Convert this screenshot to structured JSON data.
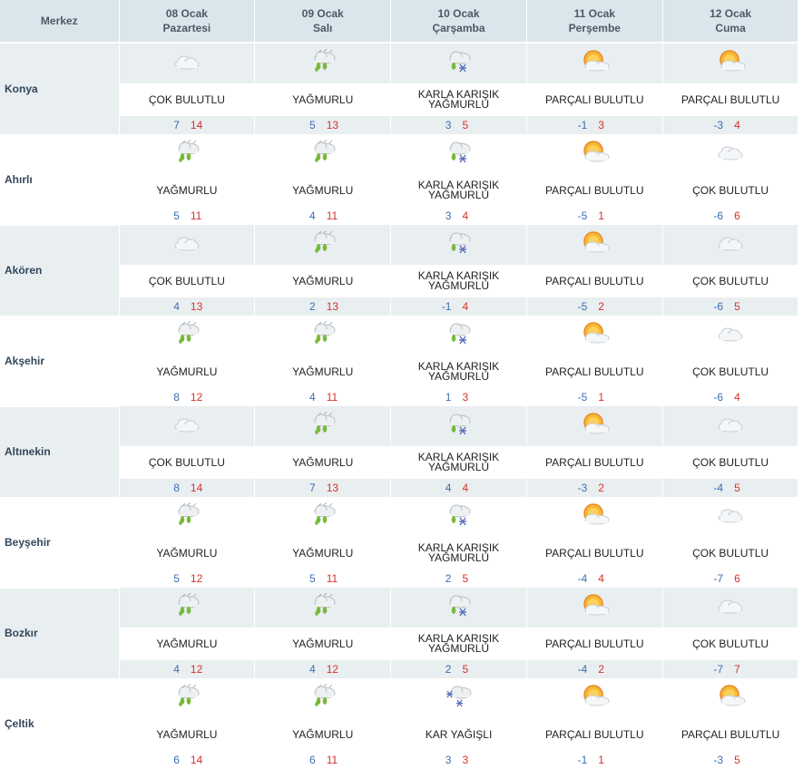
{
  "header": {
    "merkez_label": "Merkez",
    "days": [
      {
        "date": "08 Ocak",
        "weekday": "Pazartesi"
      },
      {
        "date": "09 Ocak",
        "weekday": "Salı"
      },
      {
        "date": "10 Ocak",
        "weekday": "Çarşamba"
      },
      {
        "date": "11 Ocak",
        "weekday": "Perşembe"
      },
      {
        "date": "12 Ocak",
        "weekday": "Cuma"
      }
    ]
  },
  "cities": [
    {
      "name": "Konya",
      "days": [
        {
          "icon": "cloudy-icon",
          "desc": "ÇOK BULUTLU",
          "min": "7",
          "max": "14"
        },
        {
          "icon": "rain-icon",
          "desc": "YAĞMURLU",
          "min": "5",
          "max": "13"
        },
        {
          "icon": "sleet-icon",
          "desc": "KARLA KARIŞIK YAĞMURLU",
          "min": "3",
          "max": "5"
        },
        {
          "icon": "partly-cloudy-icon",
          "desc": "PARÇALI BULUTLU",
          "min": "-1",
          "max": "3"
        },
        {
          "icon": "partly-cloudy-icon",
          "desc": "PARÇALI BULUTLU",
          "min": "-3",
          "max": "4"
        }
      ]
    },
    {
      "name": "Ahırlı",
      "days": [
        {
          "icon": "rain-icon",
          "desc": "YAĞMURLU",
          "min": "5",
          "max": "11"
        },
        {
          "icon": "rain-icon",
          "desc": "YAĞMURLU",
          "min": "4",
          "max": "11"
        },
        {
          "icon": "sleet-icon",
          "desc": "KARLA KARIŞIK YAĞMURLU",
          "min": "3",
          "max": "4"
        },
        {
          "icon": "partly-cloudy-icon",
          "desc": "PARÇALI BULUTLU",
          "min": "-5",
          "max": "1"
        },
        {
          "icon": "cloudy-icon",
          "desc": "ÇOK BULUTLU",
          "min": "-6",
          "max": "6"
        }
      ]
    },
    {
      "name": "Akören",
      "days": [
        {
          "icon": "cloudy-icon",
          "desc": "ÇOK BULUTLU",
          "min": "4",
          "max": "13"
        },
        {
          "icon": "rain-icon",
          "desc": "YAĞMURLU",
          "min": "2",
          "max": "13"
        },
        {
          "icon": "sleet-icon",
          "desc": "KARLA KARIŞIK YAĞMURLU",
          "min": "-1",
          "max": "4"
        },
        {
          "icon": "partly-cloudy-icon",
          "desc": "PARÇALI BULUTLU",
          "min": "-5",
          "max": "2"
        },
        {
          "icon": "cloudy-icon",
          "desc": "ÇOK BULUTLU",
          "min": "-6",
          "max": "5"
        }
      ]
    },
    {
      "name": "Akşehir",
      "days": [
        {
          "icon": "rain-icon",
          "desc": "YAĞMURLU",
          "min": "8",
          "max": "12"
        },
        {
          "icon": "rain-icon",
          "desc": "YAĞMURLU",
          "min": "4",
          "max": "11"
        },
        {
          "icon": "sleet-icon",
          "desc": "KARLA KARIŞIK YAĞMURLU",
          "min": "1",
          "max": "3"
        },
        {
          "icon": "partly-cloudy-icon",
          "desc": "PARÇALI BULUTLU",
          "min": "-5",
          "max": "1"
        },
        {
          "icon": "cloudy-icon",
          "desc": "ÇOK BULUTLU",
          "min": "-6",
          "max": "4"
        }
      ]
    },
    {
      "name": "Altınekin",
      "days": [
        {
          "icon": "cloudy-icon",
          "desc": "ÇOK BULUTLU",
          "min": "8",
          "max": "14"
        },
        {
          "icon": "rain-icon",
          "desc": "YAĞMURLU",
          "min": "7",
          "max": "13"
        },
        {
          "icon": "sleet-icon",
          "desc": "KARLA KARIŞIK YAĞMURLU",
          "min": "4",
          "max": "4"
        },
        {
          "icon": "partly-cloudy-icon",
          "desc": "PARÇALI BULUTLU",
          "min": "-3",
          "max": "2"
        },
        {
          "icon": "cloudy-icon",
          "desc": "ÇOK BULUTLU",
          "min": "-4",
          "max": "5"
        }
      ]
    },
    {
      "name": "Beyşehir",
      "days": [
        {
          "icon": "rain-icon",
          "desc": "YAĞMURLU",
          "min": "5",
          "max": "12"
        },
        {
          "icon": "rain-icon",
          "desc": "YAĞMURLU",
          "min": "5",
          "max": "11"
        },
        {
          "icon": "sleet-icon",
          "desc": "KARLA KARIŞIK YAĞMURLU",
          "min": "2",
          "max": "5"
        },
        {
          "icon": "partly-cloudy-icon",
          "desc": "PARÇALI BULUTLU",
          "min": "-4",
          "max": "4"
        },
        {
          "icon": "cloudy-icon",
          "desc": "ÇOK BULUTLU",
          "min": "-7",
          "max": "6"
        }
      ]
    },
    {
      "name": "Bozkır",
      "days": [
        {
          "icon": "rain-icon",
          "desc": "YAĞMURLU",
          "min": "4",
          "max": "12"
        },
        {
          "icon": "rain-icon",
          "desc": "YAĞMURLU",
          "min": "4",
          "max": "12"
        },
        {
          "icon": "sleet-icon",
          "desc": "KARLA KARIŞIK YAĞMURLU",
          "min": "2",
          "max": "5"
        },
        {
          "icon": "partly-cloudy-icon",
          "desc": "PARÇALI BULUTLU",
          "min": "-4",
          "max": "2"
        },
        {
          "icon": "cloudy-icon",
          "desc": "ÇOK BULUTLU",
          "min": "-7",
          "max": "7"
        }
      ]
    },
    {
      "name": "Çeltik",
      "days": [
        {
          "icon": "rain-icon",
          "desc": "YAĞMURLU",
          "min": "6",
          "max": "14"
        },
        {
          "icon": "rain-icon",
          "desc": "YAĞMURLU",
          "min": "6",
          "max": "11"
        },
        {
          "icon": "snow-icon",
          "desc": "KAR YAĞIŞLI",
          "min": "3",
          "max": "3"
        },
        {
          "icon": "partly-cloudy-icon",
          "desc": "PARÇALI BULUTLU",
          "min": "-1",
          "max": "1"
        },
        {
          "icon": "partly-cloudy-icon",
          "desc": "PARÇALI BULUTLU",
          "min": "-3",
          "max": "5"
        }
      ]
    }
  ]
}
